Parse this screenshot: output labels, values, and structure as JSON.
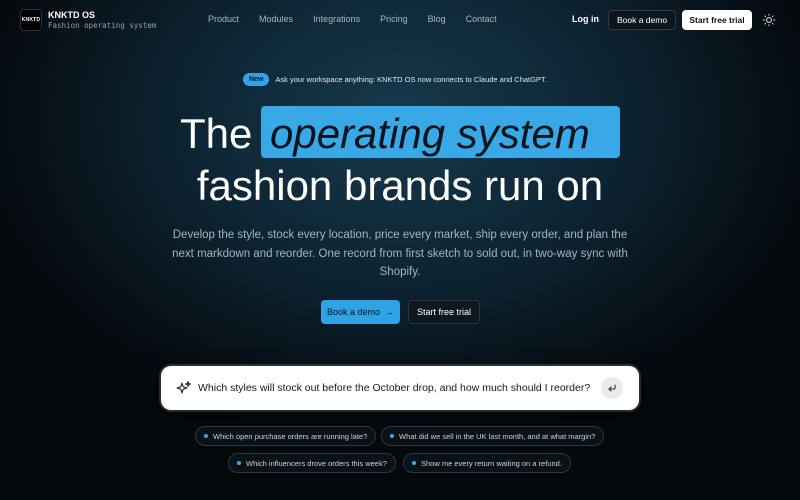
{
  "nav": {
    "logo_text": "KNKTD",
    "brand_name": "KNKTD OS",
    "brand_sub": "Fashion operating system",
    "links": [
      {
        "label": "Product"
      },
      {
        "label": "Modules"
      },
      {
        "label": "Integrations"
      },
      {
        "label": "Pricing"
      },
      {
        "label": "Blog"
      },
      {
        "label": "Contact"
      }
    ],
    "login": "Log in",
    "book_demo": "Book a demo",
    "start_trial": "Start free trial",
    "theme_icon": "sun-icon"
  },
  "announcement": {
    "badge": "New",
    "text": "Ask your workspace anything: KNKTD OS now connects to Claude and ChatGPT."
  },
  "hero": {
    "line1_prefix": "The",
    "line1_highlight": "operating system",
    "line2": "fashion brands run on",
    "description": "Develop the style, stock every location, price every market, ship every order, and plan the next markdown and reorder. One record from first sketch to sold out, in two-way sync with Shopify."
  },
  "cta": {
    "demo": "Book a demo",
    "demo_arrow": "→",
    "trial": "Start free trial"
  },
  "search": {
    "value": "Which styles will stock out before the October drop, and how much should I reorder?",
    "icon": "sparkle-icon",
    "submit_icon": "return-icon"
  },
  "suggestions": [
    {
      "label": "Which open purchase orders are running late?"
    },
    {
      "label": "What did we sell in the UK last month, and at what margin?"
    },
    {
      "label": "Which influencers drove orders this week?"
    },
    {
      "label": "Show me every return waiting on a refund."
    }
  ],
  "colors": {
    "accent": "#2fa5e8",
    "background": "#050a0e"
  }
}
